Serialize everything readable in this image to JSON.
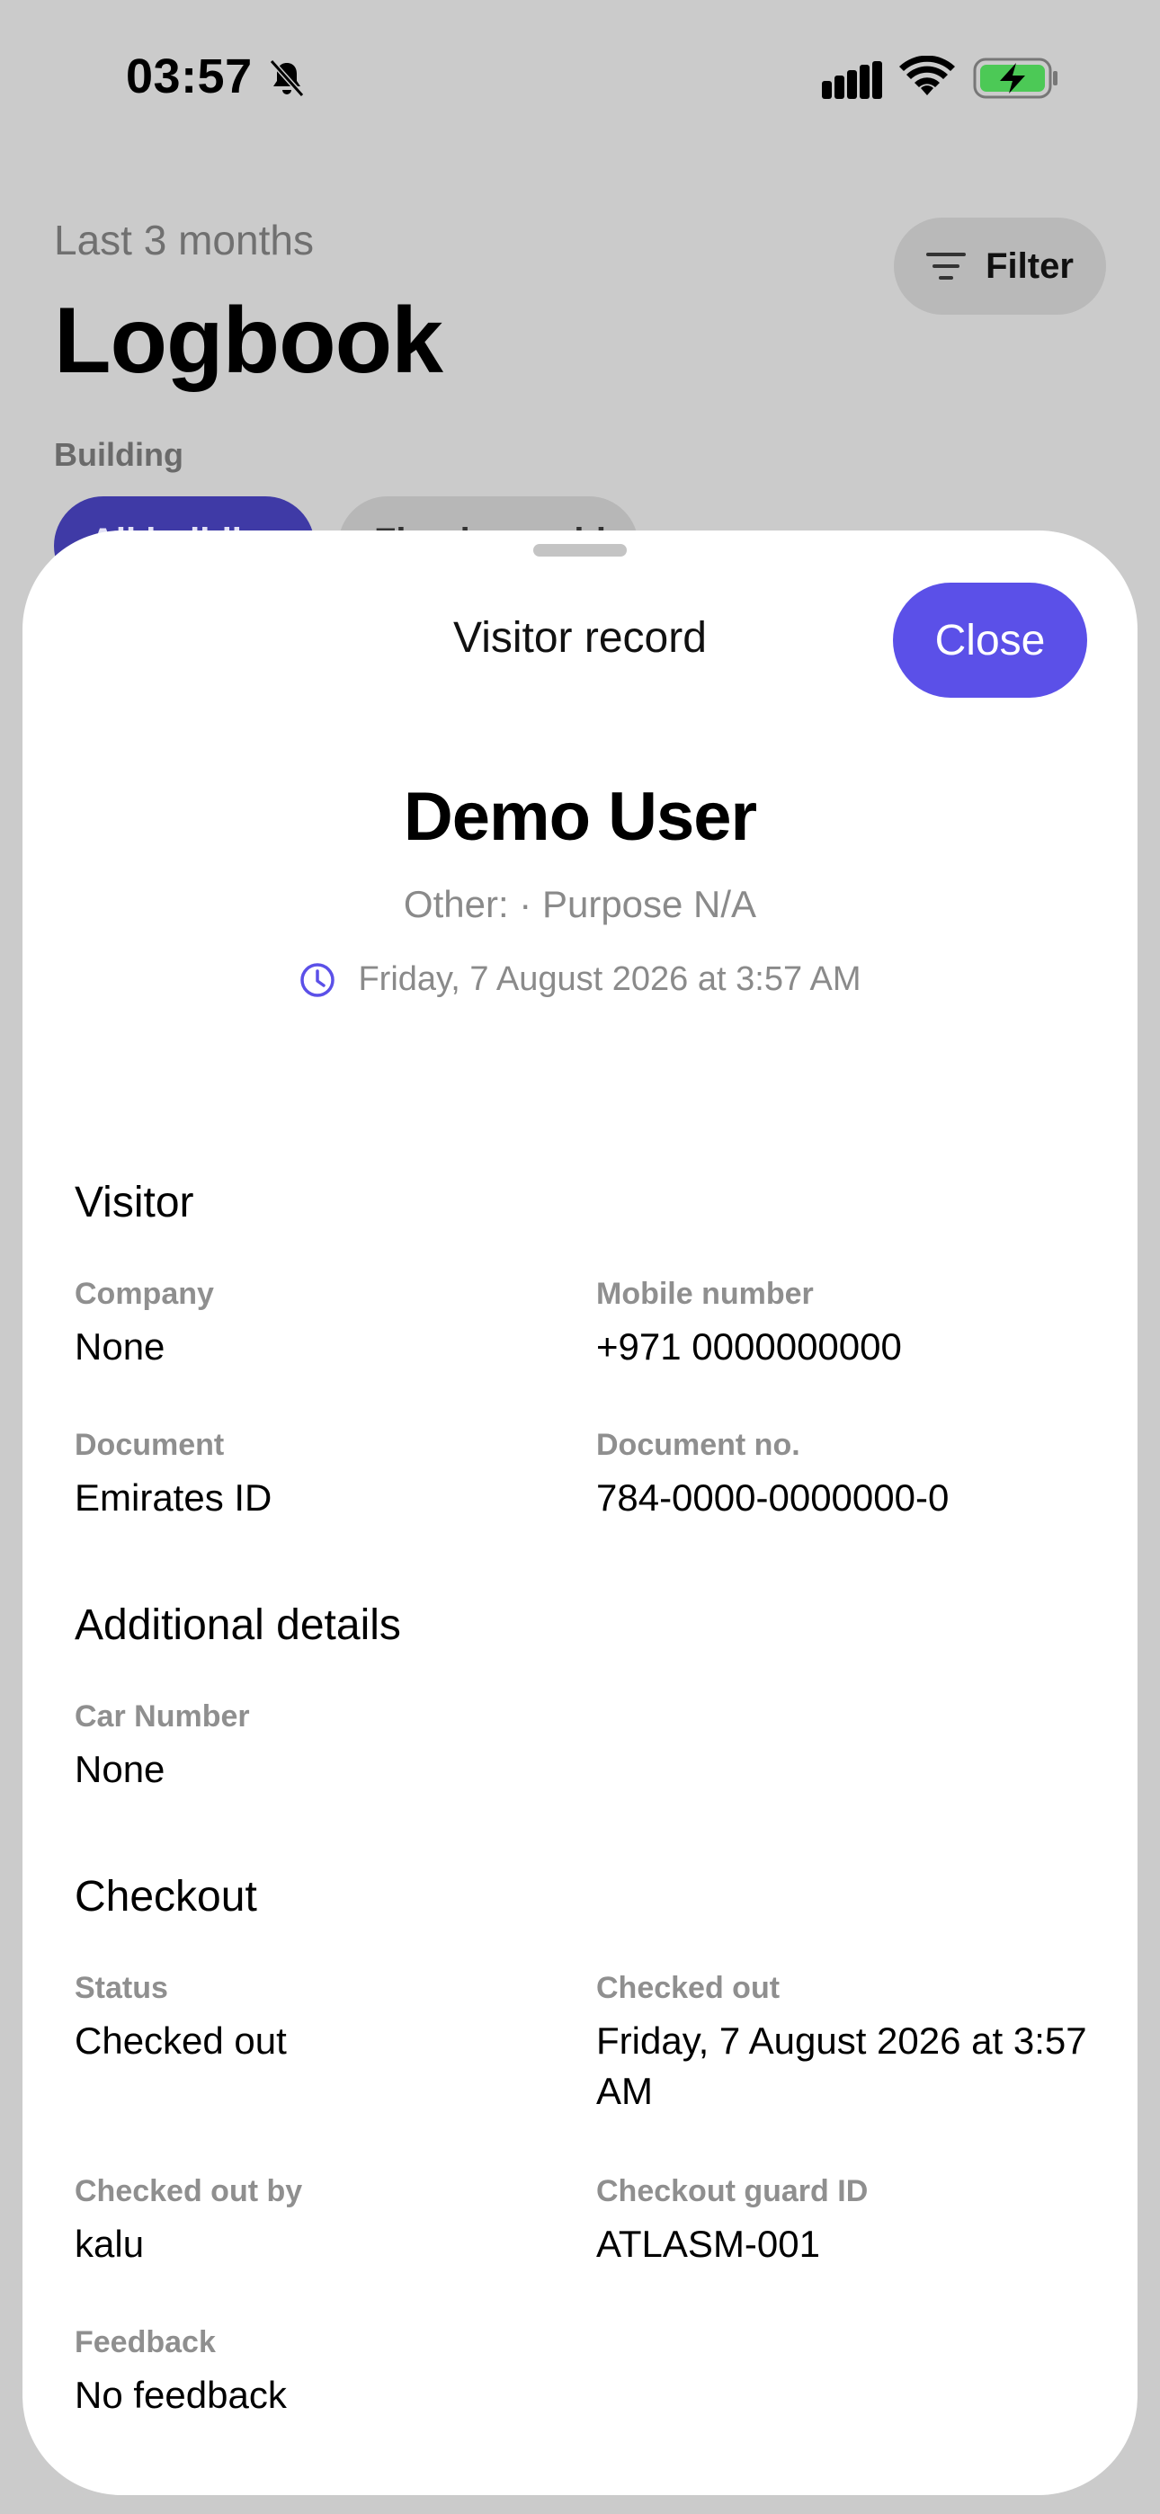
{
  "status_bar": {
    "time": "03:57"
  },
  "background": {
    "subtitle": "Last 3 months",
    "title": "Logbook",
    "filter_label": "Filter",
    "section_label": "Building",
    "chips": [
      "All buildings",
      "Fineday residence"
    ]
  },
  "sheet": {
    "title": "Visitor record",
    "close_label": "Close",
    "visitor": {
      "name": "Demo User",
      "meta": "Other:  · Purpose N/A",
      "time": "Friday, 7 August 2026 at 3:57 AM"
    },
    "sections": {
      "visitor": {
        "heading": "Visitor",
        "company_label": "Company",
        "company_value": "None",
        "mobile_label": "Mobile number",
        "mobile_value": "+971 0000000000",
        "document_label": "Document",
        "document_value": "Emirates ID",
        "document_no_label": "Document no.",
        "document_no_value": "784-0000-0000000-0"
      },
      "additional": {
        "heading": "Additional details",
        "car_label": "Car Number",
        "car_value": "None"
      },
      "checkout": {
        "heading": "Checkout",
        "status_label": "Status",
        "status_value": "Checked out",
        "checked_out_label": "Checked out",
        "checked_out_value": "Friday, 7 August 2026 at 3:57 AM",
        "by_label": "Checked out by",
        "by_value": "kalu",
        "guard_label": "Checkout guard ID",
        "guard_value": "ATLASM-001",
        "feedback_label": "Feedback",
        "feedback_value": "No feedback"
      }
    }
  },
  "colors": {
    "accent": "#5b50e8",
    "battery": "#4cc956",
    "overlay": "#cbcbcb"
  }
}
